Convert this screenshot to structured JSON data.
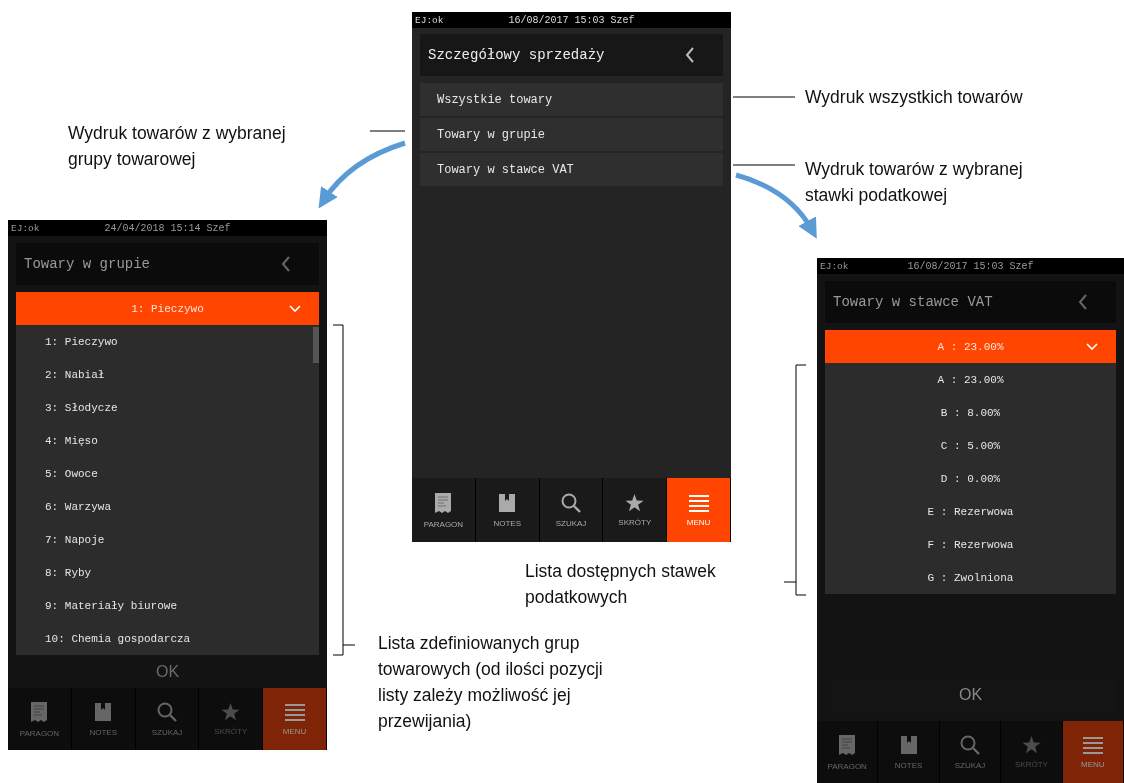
{
  "screens": [
    {
      "kind": "menu",
      "dimmed": false,
      "status_left": "EJ:ok",
      "status_center": "16/08/2017 15:03 Szef",
      "title": "Szczegółowy sprzedaży",
      "items": [
        "Wszystkie towary",
        "Towary w grupie",
        "Towary w stawce VAT"
      ],
      "nav": [
        {
          "kind": "receipt",
          "label": "PARAGON",
          "selected": false,
          "disabled": false
        },
        {
          "kind": "notebook",
          "label": "NOTES",
          "selected": false,
          "disabled": false
        },
        {
          "kind": "search",
          "label": "SZUKAJ",
          "selected": false,
          "disabled": false
        },
        {
          "kind": "star",
          "label": "SKRÓTY",
          "selected": false,
          "disabled": false
        },
        {
          "kind": "menu",
          "label": "MENU",
          "selected": true,
          "disabled": false
        }
      ]
    },
    {
      "kind": "group-picker",
      "dimmed": true,
      "status_left": "EJ:ok",
      "status_center": "24/04/2018 15:14 Szef",
      "title": "Towary w grupie",
      "dropdown_value": "1: Pieczywo",
      "ok": "OK",
      "options": [
        "1: Pieczywo",
        "2: Nabiał",
        "3: Słodycze",
        "4: Mięso",
        "5: Owoce",
        "6: Warzywa",
        "7: Napoje",
        "8: Ryby",
        "9: Materiały biurowe",
        "10: Chemia gospodarcza"
      ],
      "nav": [
        {
          "kind": "receipt",
          "label": "PARAGON",
          "selected": false,
          "disabled": false
        },
        {
          "kind": "notebook",
          "label": "NOTES",
          "selected": false,
          "disabled": false
        },
        {
          "kind": "search",
          "label": "SZUKAJ",
          "selected": false,
          "disabled": false
        },
        {
          "kind": "star",
          "label": "SKRÓTY",
          "selected": false,
          "disabled": true
        },
        {
          "kind": "menu",
          "label": "MENU",
          "selected": true,
          "disabled": false
        }
      ]
    },
    {
      "kind": "vat-picker",
      "dimmed": true,
      "status_left": "EJ:ok",
      "status_center": "16/08/2017 15:03 Szef",
      "title": "Towary w stawce VAT",
      "dropdown_value": "A : 23.00%",
      "ok": "OK",
      "options": [
        "A : 23.00%",
        "B : 8.00%",
        "C : 5.00%",
        "D : 0.00%",
        "E : Rezerwowa",
        "F : Rezerwowa",
        "G : Zwolniona"
      ],
      "nav": [
        {
          "kind": "receipt",
          "label": "PARAGON",
          "selected": false,
          "disabled": false
        },
        {
          "kind": "notebook",
          "label": "NOTES",
          "selected": false,
          "disabled": false
        },
        {
          "kind": "search",
          "label": "SZUKAJ",
          "selected": false,
          "disabled": false
        },
        {
          "kind": "star",
          "label": "SKRÓTY",
          "selected": false,
          "disabled": true
        },
        {
          "kind": "menu",
          "label": "MENU",
          "selected": true,
          "disabled": false
        }
      ]
    }
  ],
  "annotations": [
    {
      "lines": [
        "Wydruk towarów z wybranej",
        "grupy towarowej"
      ]
    },
    {
      "lines": [
        "Wydruk wszystkich towarów"
      ]
    },
    {
      "lines": [
        "Wydruk towarów z wybranej",
        "stawki podatkowej"
      ]
    },
    {
      "lines": [
        "Lista dostępnych stawek",
        "podatkowych"
      ]
    },
    {
      "lines": [
        "Lista zdefiniowanych grup",
        "towarowych (od ilości pozycji",
        "listy zależy możliwość jej",
        "przewijania)"
      ]
    }
  ]
}
